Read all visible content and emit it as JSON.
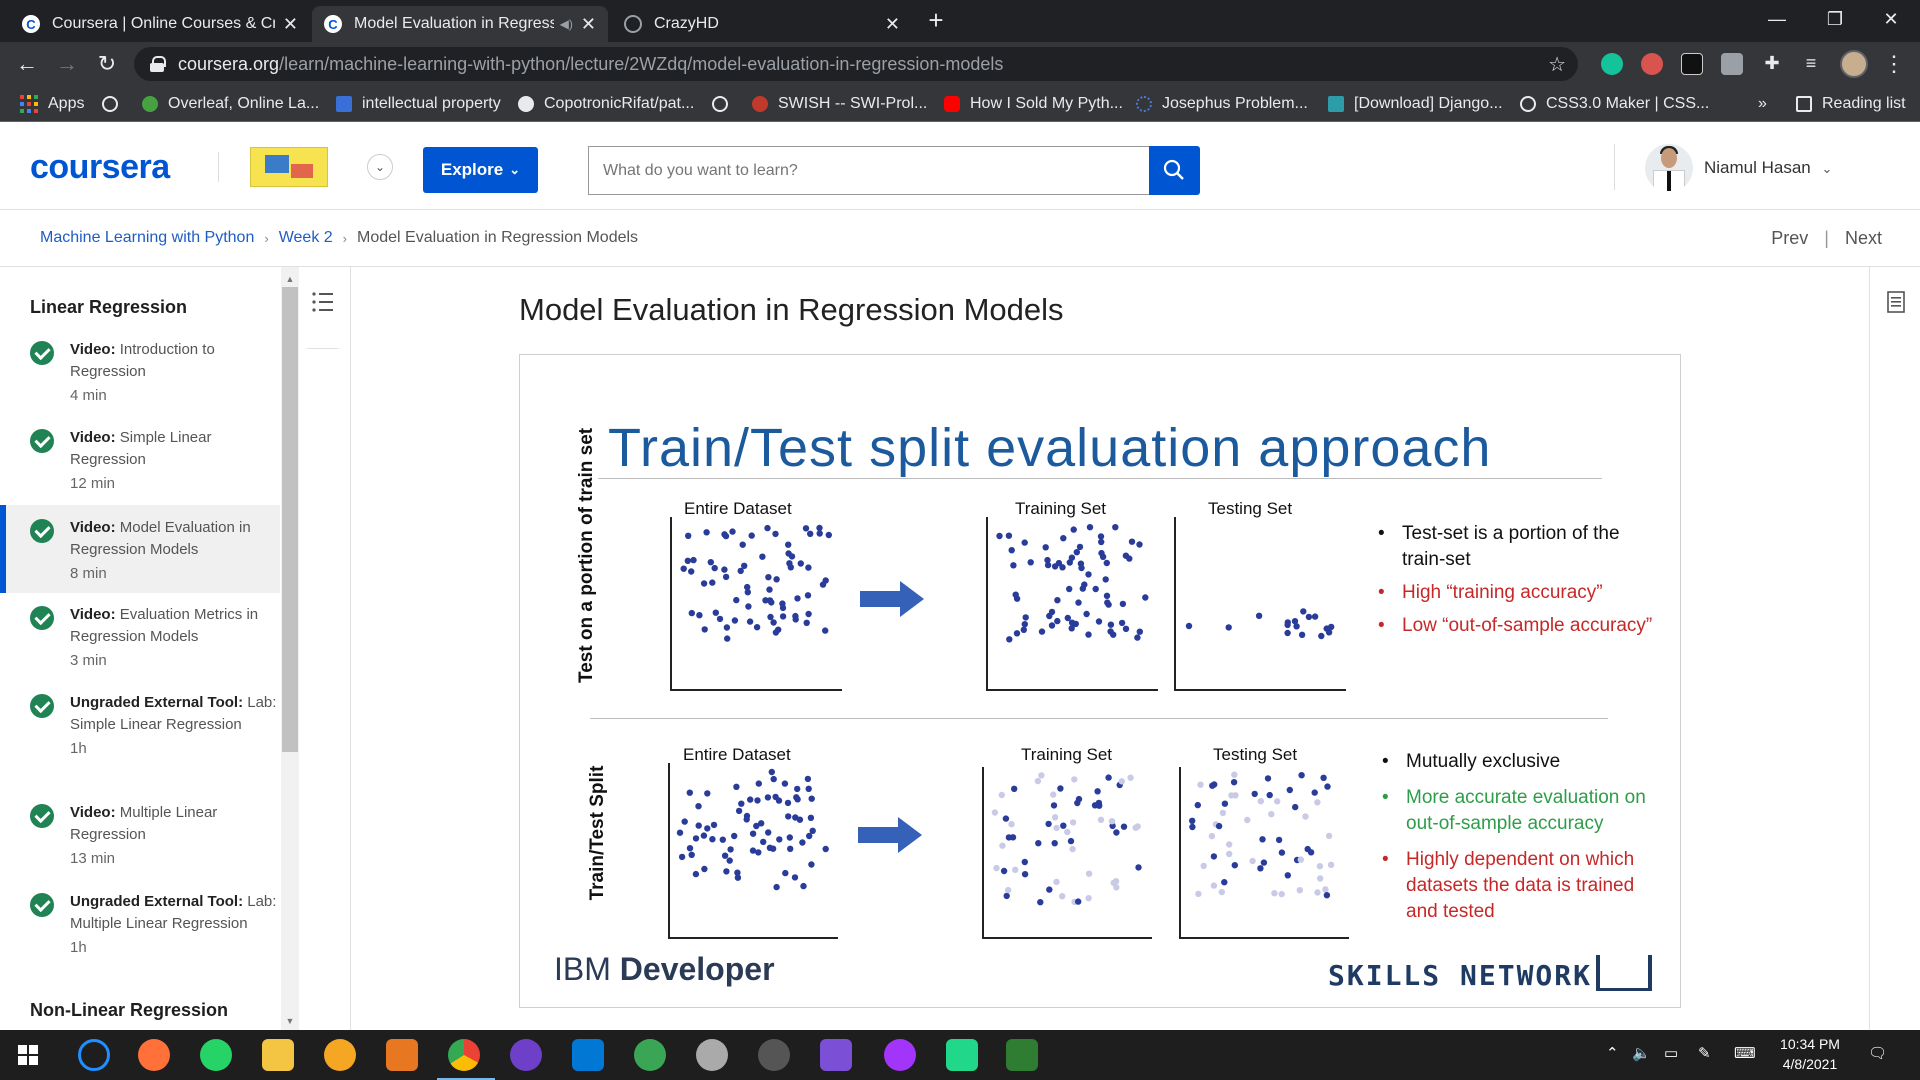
{
  "browser": {
    "tabs": [
      {
        "title": "Coursera | Online Courses & Cre",
        "active": false
      },
      {
        "title": "Model Evaluation in Regressi",
        "active": true
      },
      {
        "title": "CrazyHD",
        "active": false
      }
    ],
    "url_host": "coursera.org",
    "url_path": "/learn/machine-learning-with-python/lecture/2WZdq/model-evaluation-in-regression-models",
    "bookmarks": [
      "Apps",
      "Overleaf, Online La...",
      "intellectual property",
      "CopotronicRifat/pat...",
      "SWISH -- SWI-Prol...",
      "How I Sold My Pyth...",
      "Josephus Problem...",
      "[Download] Django...",
      "CSS3.0 Maker | CSS..."
    ],
    "bookmarks_overflow": "»",
    "reading_list": "Reading list"
  },
  "header": {
    "logo": "coursera",
    "explore_label": "Explore",
    "search_placeholder": "What do you want to learn?",
    "user_name": "Niamul Hasan"
  },
  "breadcrumb": {
    "items": [
      "Machine Learning with Python",
      "Week 2"
    ],
    "current": "Model Evaluation in Regression Models",
    "prev": "Prev",
    "next": "Next"
  },
  "sidebar": {
    "section_title": "Linear Regression",
    "items": [
      {
        "kind": "Video:",
        "title": "Introduction to Regression",
        "duration": "4 min"
      },
      {
        "kind": "Video:",
        "title": "Simple Linear Regression",
        "duration": "12 min"
      },
      {
        "kind": "Video:",
        "title": "Model Evaluation in Regression Models",
        "duration": "8 min"
      },
      {
        "kind": "Video:",
        "title": "Evaluation Metrics in Regression Models",
        "duration": "3 min"
      },
      {
        "kind": "Ungraded External Tool:",
        "title": "Lab: Simple Linear Regression",
        "duration": "1h"
      },
      {
        "kind": "Video:",
        "title": "Multiple Linear Regression",
        "duration": "13 min"
      },
      {
        "kind": "Ungraded External Tool:",
        "title": "Lab: Multiple Linear Regression",
        "duration": "1h"
      }
    ],
    "next_section_title": "Non-Linear Regression"
  },
  "main": {
    "lecture_title": "Model Evaluation in Regression Models"
  },
  "slide": {
    "title": "Train/Test split evaluation approach",
    "row1": {
      "label": "Test on a portion of train set",
      "panels": [
        "Entire Dataset",
        "Training Set",
        "Testing Set"
      ],
      "bullets": [
        {
          "text": "Test-set is a portion of the train-set",
          "color": "#111111"
        },
        {
          "text": "High “training accuracy”",
          "color": "#c62828"
        },
        {
          "text": "Low “out-of-sample accuracy”",
          "color": "#c62828"
        }
      ]
    },
    "row2": {
      "label": "Train/Test Split",
      "panels": [
        "Entire Dataset",
        "Training Set",
        "Testing Set"
      ],
      "bullets": [
        {
          "text": "Mutually exclusive",
          "color": "#111111"
        },
        {
          "text": "More accurate evaluation on out-of-sample accuracy",
          "color": "#2e9d4a"
        },
        {
          "text": "Highly dependent on which datasets the data is trained and tested",
          "color": "#c62828"
        }
      ]
    },
    "footer_left_prefix": "IBM",
    "footer_left_bold": "Developer",
    "footer_right": "SKILLS NETWORK"
  },
  "taskbar": {
    "time": "10:34 PM",
    "date": "4/8/2021"
  },
  "colors": {
    "coursera_blue": "#0056d2",
    "check_green": "#1f8354",
    "slide_title_blue": "#1c5a9e",
    "dot_blue": "#2a3c9a"
  }
}
